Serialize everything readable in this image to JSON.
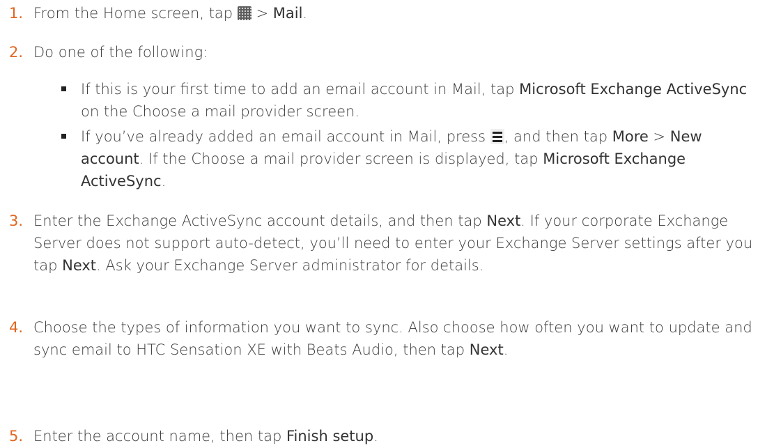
{
  "steps": [
    {
      "num": "1.",
      "t1": "From the Home screen, tap ",
      "t2": " > ",
      "b1": "Mail",
      "t3": "."
    },
    {
      "num": "2.",
      "t1": "Do one of the following:",
      "bullets": [
        {
          "t1": "If this is your first time to add an email account in Mail, tap ",
          "b1": "Microsoft Exchange ActiveSync",
          "t2": " on the Choose a mail provider screen."
        },
        {
          "t1": "If you’ve already added an email account in Mail, press ",
          "t2": ", and then tap ",
          "b1": "More",
          "t3": " > ",
          "b2": "New account",
          "t4": ". If the Choose a mail provider screen is displayed, tap ",
          "b3": "Microsoft Exchange ActiveSync",
          "t5": "."
        }
      ]
    },
    {
      "num": "3.",
      "t1": "Enter the Exchange ActiveSync account details, and then tap ",
      "b1": "Next",
      "t2": ". If your corporate Exchange Server does not support auto-detect, you’ll need to enter your Exchange Server settings after you tap ",
      "b2": "Next",
      "t3": ". Ask your Exchange Server administrator for details."
    },
    {
      "num": "4.",
      "t1": "Choose the types of information you want to sync. Also choose how often you want to update and sync email to HTC Sensation XE with Beats Audio, then tap ",
      "b1": "Next",
      "t2": "."
    },
    {
      "num": "5.",
      "t1": "Enter the account name, then tap ",
      "b1": "Finish setup",
      "t2": "."
    }
  ],
  "icons": {
    "all_apps": "all-apps-grid-icon",
    "menu": "menu-icon"
  },
  "colors": {
    "step_number": "#e0661f",
    "text": "#3a3a3a"
  }
}
